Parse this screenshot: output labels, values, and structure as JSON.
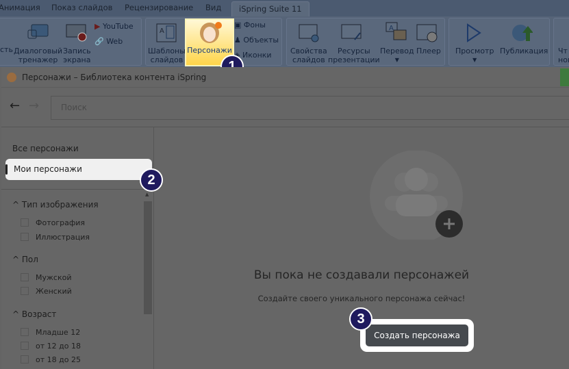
{
  "ribbon_tabs": [
    "Анимация",
    "Показ слайдов",
    "Рецензирование",
    "Вид",
    "iSpring Suite 11"
  ],
  "ribbon": {
    "partial_left": "сть",
    "dialog_trainer": [
      "Диалоговый",
      "тренажер"
    ],
    "screen_record": [
      "Запись",
      "экрана"
    ],
    "youtube": "YouTube",
    "web": "Web",
    "templates": [
      "Шаблоны",
      "слайдов"
    ],
    "characters": "Персонажи",
    "backgrounds": "Фоны",
    "objects": "Объекты",
    "icons": "Иконки",
    "slide_props": [
      "Свойства",
      "слайдов"
    ],
    "resources": [
      "Ресурсы",
      "презентации"
    ],
    "translate": "Перевод",
    "player": "Плеер",
    "preview": "Просмотр",
    "publish": "Публикация",
    "partial_right": [
      "Чт",
      "нов"
    ]
  },
  "dialog": {
    "title": "Персонажи – Библиотека контента iSpring",
    "search_placeholder": "Поиск",
    "all_characters": "Все персонажи",
    "my_characters": "Мои персонажи",
    "filters": [
      {
        "title": "Тип изображения",
        "options": [
          "Фотография",
          "Иллюстрация"
        ]
      },
      {
        "title": "Пол",
        "options": [
          "Мужской",
          "Женский"
        ]
      },
      {
        "title": "Возраст",
        "options": [
          "Младше 12",
          "от 12 до 18",
          "от 18 до 25"
        ]
      }
    ],
    "empty_title": "Вы пока не создавали персонажей",
    "empty_sub": "Создайте своего уникального персонажа сейчас!",
    "create_button": "Создать персонажа"
  },
  "badges": [
    "1",
    "2",
    "3"
  ]
}
